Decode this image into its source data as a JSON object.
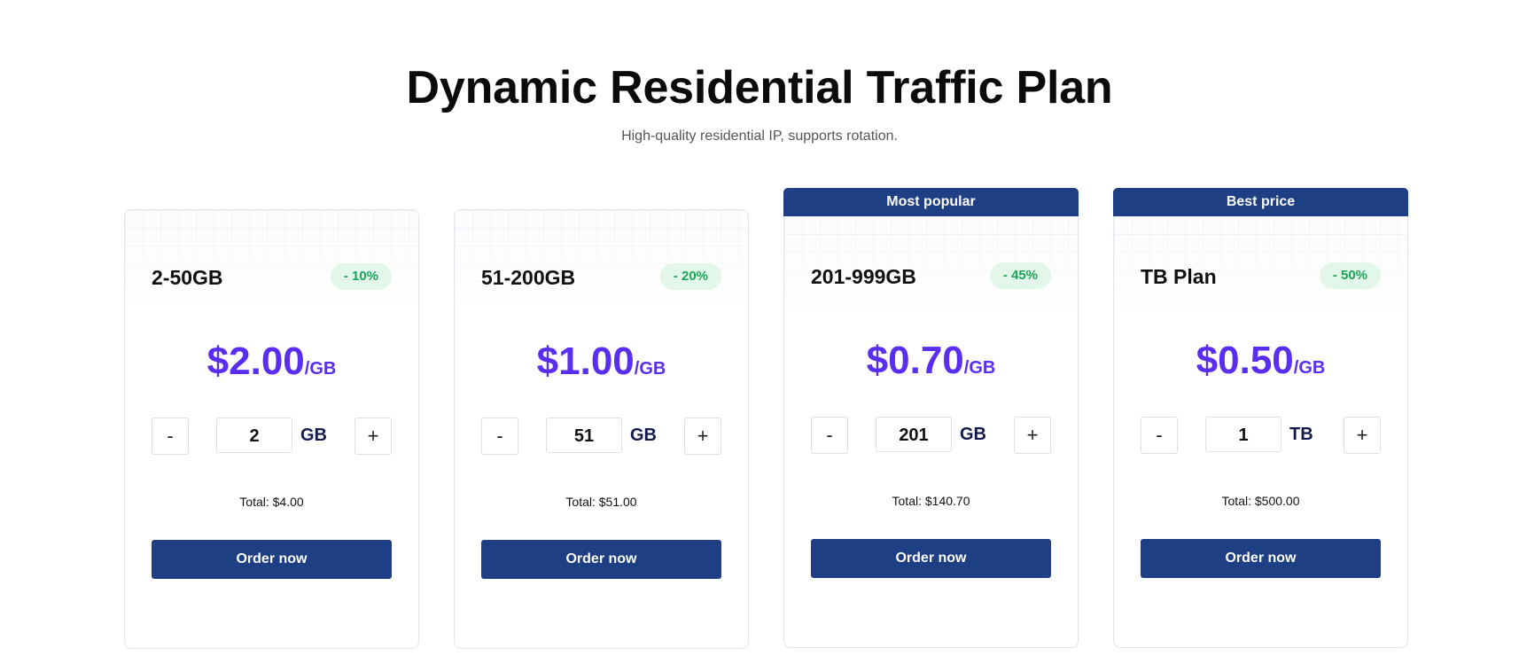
{
  "header": {
    "title": "Dynamic Residential Traffic Plan",
    "subtitle": "High-quality residential IP, supports rotation."
  },
  "plans": [
    {
      "ribbon": "",
      "name": "2-50GB",
      "discount": "- 10%",
      "price": "$2.00",
      "price_unit": "/GB",
      "quantity": "2",
      "quantity_unit": "GB",
      "minus_label": "-",
      "plus_label": "+",
      "total": "Total: $4.00",
      "order_label": "Order now"
    },
    {
      "ribbon": "",
      "name": "51-200GB",
      "discount": "- 20%",
      "price": "$1.00",
      "price_unit": "/GB",
      "quantity": "51",
      "quantity_unit": "GB",
      "minus_label": "-",
      "plus_label": "+",
      "total": "Total: $51.00",
      "order_label": "Order now"
    },
    {
      "ribbon": "Most popular",
      "name": "201-999GB",
      "discount": "- 45%",
      "price": "$0.70",
      "price_unit": "/GB",
      "quantity": "201",
      "quantity_unit": "GB",
      "minus_label": "-",
      "plus_label": "+",
      "total": "Total: $140.70",
      "order_label": "Order now"
    },
    {
      "ribbon": "Best price",
      "name": "TB Plan",
      "discount": "- 50%",
      "price": "$0.50",
      "price_unit": "/GB",
      "quantity": "1",
      "quantity_unit": "TB",
      "minus_label": "-",
      "plus_label": "+",
      "total": "Total: $500.00",
      "order_label": "Order now"
    }
  ],
  "colors": {
    "brand_navy": "#1e3f84",
    "price_purple": "#5a2ef0",
    "discount_green": "#1ba55a",
    "discount_bg": "#e3f6ea"
  }
}
